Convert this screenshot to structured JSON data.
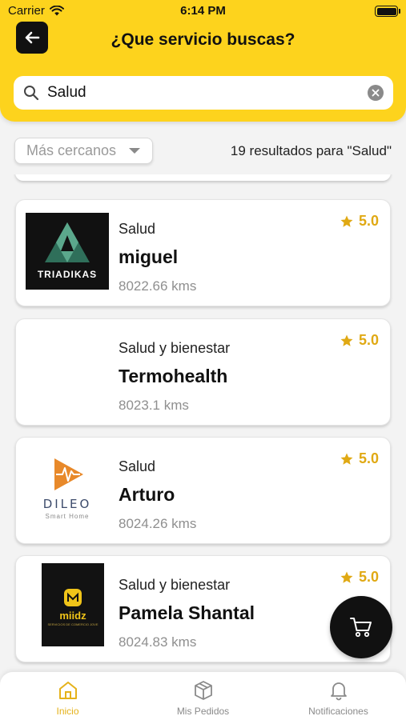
{
  "status_bar": {
    "carrier": "Carrier",
    "time": "6:14 PM"
  },
  "header": {
    "title": "¿Que servicio buscas?"
  },
  "search": {
    "value": "Salud"
  },
  "filter": {
    "sort_label": "Más cercanos",
    "results_text": "19 resultados para  \"Salud\""
  },
  "results": [
    {
      "category": "Salud",
      "name": "miguel",
      "distance": "8022.66 kms",
      "rating": "5.0",
      "logo": "triadikas-logo",
      "logo_text": "TRIADIKAS"
    },
    {
      "category": "Salud y bienestar",
      "name": "Termohealth",
      "distance": "8023.1 kms",
      "rating": "5.0",
      "logo": "none"
    },
    {
      "category": "Salud",
      "name": "Arturo",
      "distance": "8024.26 kms",
      "rating": "5.0",
      "logo": "dileo-logo",
      "logo_text": "DILEO",
      "logo_subtext": "Smart Home"
    },
    {
      "category": "Salud y bienestar",
      "name": "Pamela Shantal",
      "distance": "8024.83 kms",
      "rating": "5.0",
      "logo": "miidz-logo",
      "logo_text": "miidz",
      "logo_subtext": "SERVICIOS DE COMERCIO JOVE"
    }
  ],
  "bottom_nav": [
    {
      "label": "Inicio",
      "icon": "home-icon",
      "active": true
    },
    {
      "label": "Mis Pedidos",
      "icon": "package-icon",
      "active": false
    },
    {
      "label": "Notificaciones",
      "icon": "bell-icon",
      "active": false
    }
  ],
  "colors": {
    "brand_yellow": "#fdd31d",
    "rating_gold": "#e0a914",
    "active_tab": "#e5b21a",
    "dark": "#111111"
  }
}
